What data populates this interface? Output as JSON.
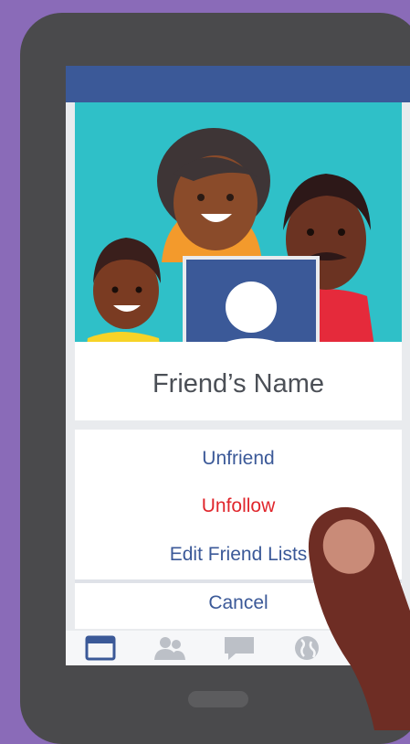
{
  "profile": {
    "name": "Friend’s Name"
  },
  "menu": {
    "unfriend": "Unfriend",
    "unfollow": "Unfollow",
    "edit_lists": "Edit Friend Lists",
    "cancel": "Cancel"
  },
  "tabs": [
    {
      "icon": "news-feed-icon",
      "active": true
    },
    {
      "icon": "friends-icon",
      "active": false
    },
    {
      "icon": "messages-icon",
      "active": false
    },
    {
      "icon": "globe-icon",
      "active": false
    },
    {
      "icon": "menu-icon",
      "active": false
    }
  ],
  "colors": {
    "brand": "#3b5998",
    "danger": "#e0262c",
    "cover": "#2fc0c8",
    "background": "#8a6bb8"
  }
}
